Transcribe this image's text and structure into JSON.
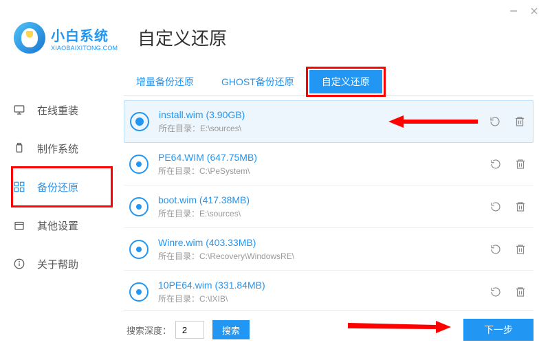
{
  "brand": {
    "name": "小白系统",
    "sub": "XIAOBAIXITONG.COM"
  },
  "page_title": "自定义还原",
  "sidebar": {
    "items": [
      {
        "label": "在线重装",
        "icon": "monitor-icon"
      },
      {
        "label": "制作系统",
        "icon": "usb-icon"
      },
      {
        "label": "备份还原",
        "icon": "grid-icon",
        "active": true
      },
      {
        "label": "其他设置",
        "icon": "box-icon"
      },
      {
        "label": "关于帮助",
        "icon": "info-icon"
      }
    ]
  },
  "tabs": [
    {
      "label": "增量备份还原"
    },
    {
      "label": "GHOST备份还原"
    },
    {
      "label": "自定义还原",
      "active": true
    }
  ],
  "files": [
    {
      "name": "install.wim (3.90GB)",
      "path": "所在目录：E:\\sources\\",
      "selected": true
    },
    {
      "name": "PE64.WIM (647.75MB)",
      "path": "所在目录：C:\\PeSystem\\"
    },
    {
      "name": "boot.wim (417.38MB)",
      "path": "所在目录：E:\\sources\\"
    },
    {
      "name": "Winre.wim (403.33MB)",
      "path": "所在目录：C:\\Recovery\\WindowsRE\\"
    },
    {
      "name": "10PE64.wim (331.84MB)",
      "path": "所在目录：C:\\IXIB\\"
    }
  ],
  "footer": {
    "depth_label": "搜索深度：",
    "depth_value": "2",
    "search_label": "搜索",
    "next_label": "下一步"
  },
  "colors": {
    "accent": "#2196f3",
    "annotation": "#f00"
  }
}
